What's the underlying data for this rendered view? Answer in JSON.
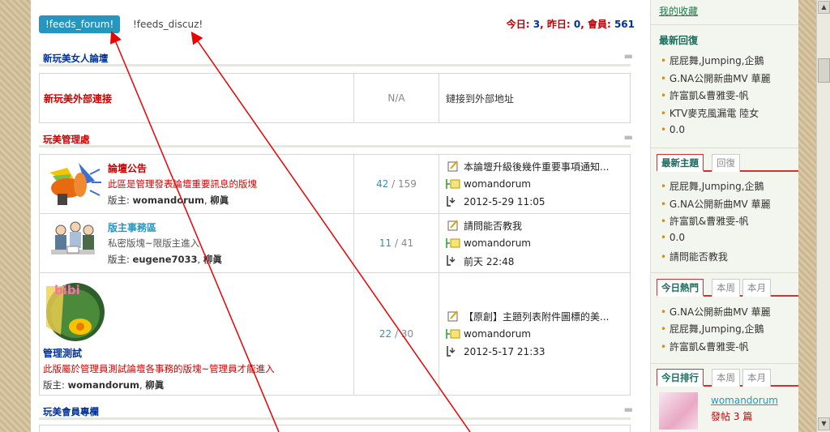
{
  "top": {
    "tab_active": "!feeds_forum!",
    "tab_other": "!feeds_discuz!",
    "stats_today_label": "今日:",
    "stats_today": "3",
    "stats_yesterday_label": "昨日:",
    "stats_yesterday": "0",
    "stats_members_label": "會員:",
    "stats_members": "561"
  },
  "categories": {
    "c1": "新玩美女人論壇",
    "c2": "玩美管理處",
    "c3": "玩美會員專欄"
  },
  "colors": {
    "category": "#003399",
    "category_red": "#cc0000",
    "accent": "#2596be"
  },
  "external": {
    "name": "新玩美外部連接",
    "na": "N/A",
    "desc": "鏈接到外部地址"
  },
  "forums": [
    {
      "name": "論壇公告",
      "desc": "此區是管理發表論壇重要訊息的版塊",
      "mods_label": "版主:",
      "mod1": "womandorum",
      "mod2": "柳眞",
      "threads": "42",
      "posts": "159",
      "lp_title": "本論壇升級後幾件重要事項通知...",
      "lp_user": "womandorum",
      "lp_time": "2012-5-29 11:05"
    },
    {
      "name": "版主事務區",
      "desc": "私密版塊~限版主進入",
      "mods_label": "版主:",
      "mod1": "eugene7033",
      "mod2": "柳眞",
      "threads": "11",
      "posts": "41",
      "lp_title": "請問能否教我",
      "lp_user": "womandorum",
      "lp_time": "前天 22:48"
    },
    {
      "name": "管理測試",
      "desc": "此版屬於管理員測試論壇各事務的版塊~管理員才能進入",
      "mods_label": "版主:",
      "mod1": "womandorum",
      "mod2": "柳眞",
      "threads": "22",
      "posts": "30",
      "lp_title": "【原創】主題列表附件圖標的美...",
      "lp_user": "womandorum",
      "lp_time": "2012-5-17 21:33",
      "logo_text": "bibi"
    }
  ],
  "sidebar": {
    "favorites": "我的收藏",
    "latest_replies_title": "最新回復",
    "latest_replies": [
      "屁屁舞,Jumping,企鵝",
      "G.NA公開新曲MV 華麗",
      "許富凱&曹雅雯-帆",
      "KTV麥克風漏電 陸女",
      "0.0"
    ],
    "topics_tab_on": "最新主題",
    "topics_tab_off": "回復",
    "topics": [
      "屁屁舞,Jumping,企鵝",
      "G.NA公開新曲MV 華麗",
      "許富凱&曹雅雯-帆",
      "0.0",
      "請問能否教我"
    ],
    "hot_tab_on": "今日熱門",
    "hot_tab_week": "本周",
    "hot_tab_month": "本月",
    "hot": [
      "G.NA公開新曲MV 華麗",
      "屁屁舞,Jumping,企鵝",
      "許富凱&曹雅雯-帆"
    ],
    "rank_tab_on": "今日排行",
    "rank_tab_week": "本周",
    "rank_tab_month": "本月",
    "rank_user": "womandorum",
    "rank_posts_label": "發帖",
    "rank_posts": "3",
    "rank_posts_unit": "篇"
  }
}
